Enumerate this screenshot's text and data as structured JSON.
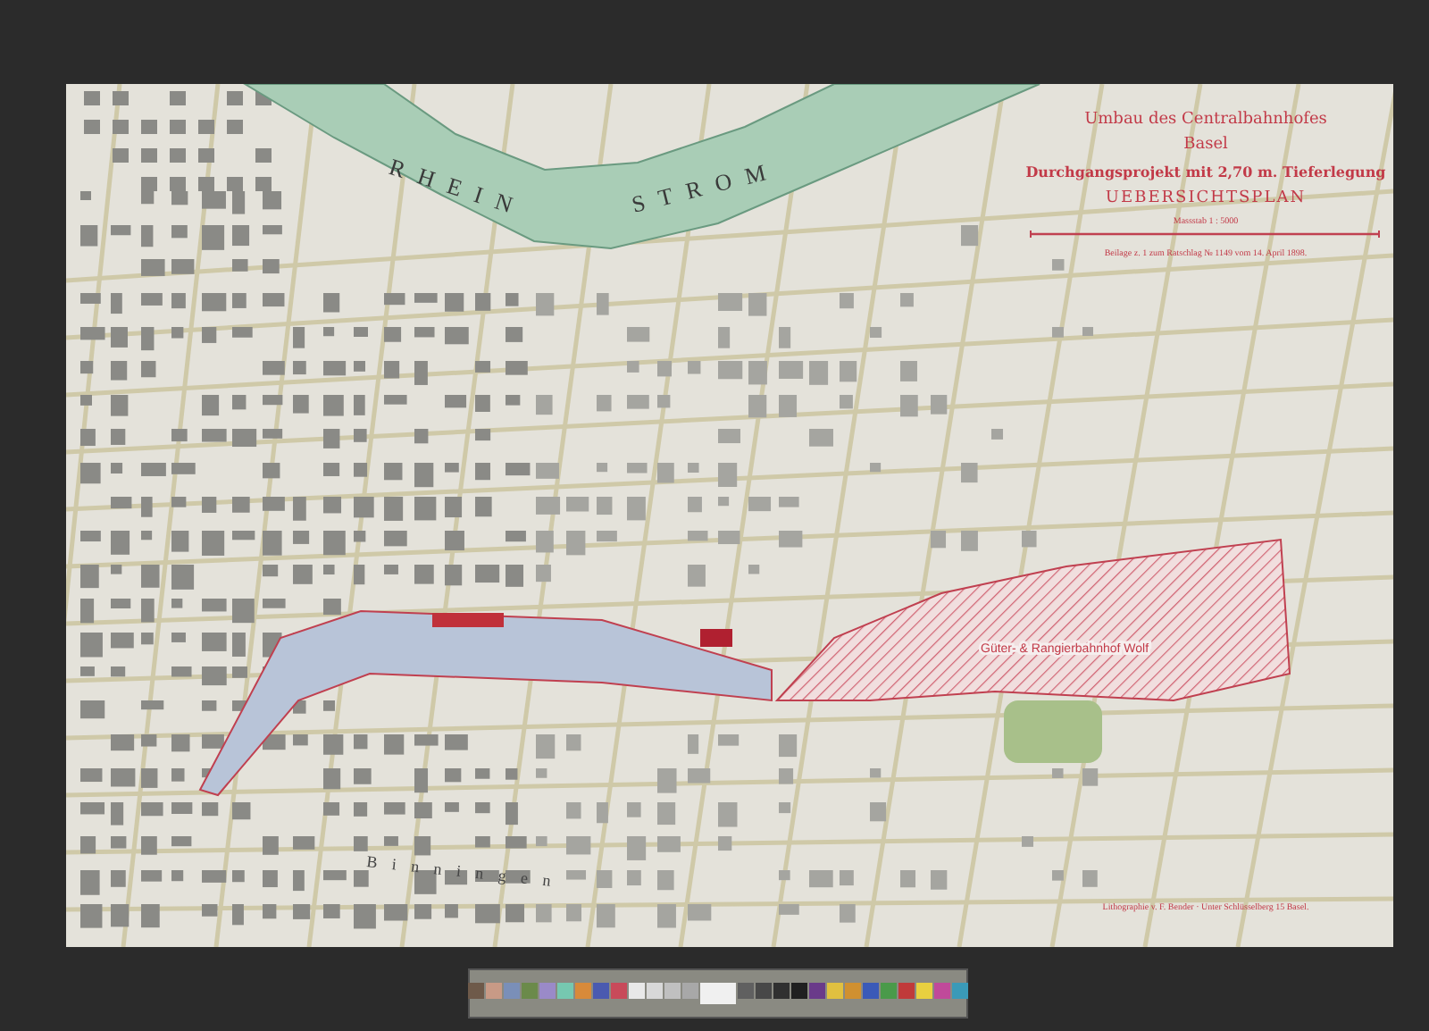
{
  "map": {
    "title_lines": [
      "Umbau des Centralbahnhofes",
      "Basel",
      "Durchgangsprojekt mit 2,70 m. Tieferlegung",
      "UEBERSICHTSPLAN"
    ],
    "scale": "Massstab 1 : 5000",
    "note": "Beilage z. 1 zum Ratschlag № 1149 vom 14. April 1898.",
    "labels": [
      {
        "kind": "river",
        "text": "RHEIN"
      },
      {
        "kind": "river",
        "text": "STROM"
      },
      {
        "kind": "area",
        "text": "Güter- & Rangierbahnhof Wolf"
      },
      {
        "kind": "place",
        "text": "B i n n i n g e n"
      }
    ],
    "credit": "Lithographie v. F. Bender · Unter Schlüsselberg 15 Basel."
  }
}
